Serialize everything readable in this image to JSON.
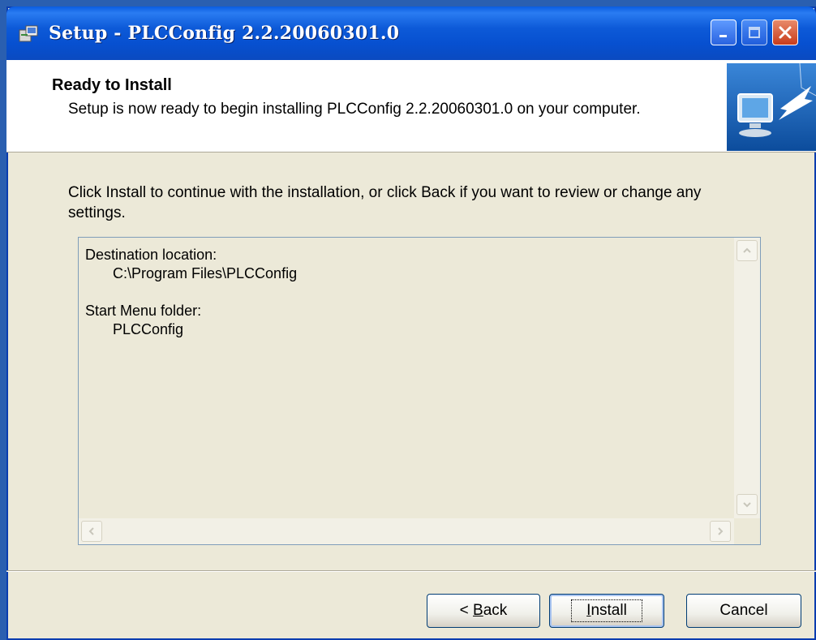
{
  "window": {
    "title": "Setup - PLCConfig 2.2.20060301.0"
  },
  "header": {
    "title": "Ready to Install",
    "subtitle": "Setup is now ready to begin installing PLCConfig 2.2.20060301.0 on your computer."
  },
  "main": {
    "instruction": "Click Install to continue with the installation, or click Back if you want to review or change any settings.",
    "memo": {
      "destination_label": "Destination location:",
      "destination_value": "C:\\Program Files\\PLCConfig",
      "start_menu_label": "Start Menu folder:",
      "start_menu_value": "PLCConfig"
    }
  },
  "buttons": {
    "back_prefix": "< ",
    "back_mnemonic": "B",
    "back_rest": "ack",
    "install_mnemonic": "I",
    "install_rest": "nstall",
    "cancel": "Cancel"
  },
  "icons": {
    "app": "setup-box-icon",
    "header": "computer-install-icon"
  },
  "colors": {
    "titlebar": "#0a5ce0",
    "dialog_bg": "#ece9d8",
    "close_button": "#c83c1c"
  }
}
